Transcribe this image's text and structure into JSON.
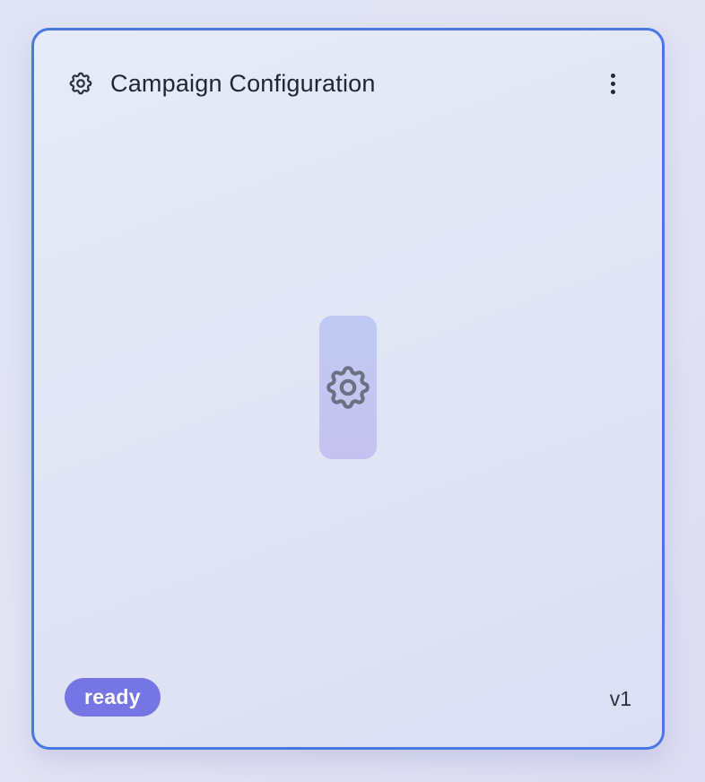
{
  "card": {
    "title": "Campaign Configuration",
    "header_icon": "gear-icon",
    "menu_icon": "more-vertical-icon",
    "center_icon": "gear-icon",
    "status": "ready",
    "version": "v1"
  },
  "colors": {
    "border": "#4a78e2",
    "badge": "#7575e4",
    "tile": "#c2c6f1",
    "title_text": "#1f2533"
  }
}
